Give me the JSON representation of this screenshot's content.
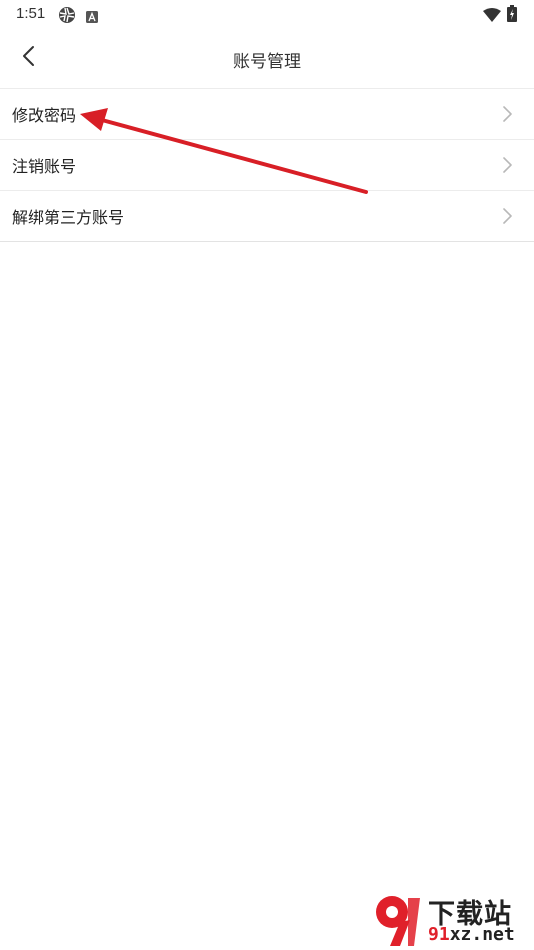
{
  "status_bar": {
    "time": "1:51",
    "icons": [
      "aperture-icon",
      "app-a-icon",
      "wifi-icon",
      "battery-charging-icon"
    ]
  },
  "header": {
    "title": "账号管理",
    "back_icon": "chevron-left-icon"
  },
  "menu": {
    "items": [
      {
        "label": "修改密码"
      },
      {
        "label": "注销账号"
      },
      {
        "label": "解绑第三方账号"
      }
    ],
    "chevron_icon": "chevron-right-icon"
  },
  "annotation": {
    "arrow_color": "#e0202a",
    "points_to": "修改密码"
  },
  "watermark": {
    "logo_text": "9",
    "brand_cn": "下载站",
    "url_part1": "91",
    "url_part2": "xz.net"
  },
  "colors": {
    "divider": "#ececec",
    "chevron": "#b8b8b8",
    "accent_red": "#e0202a"
  }
}
